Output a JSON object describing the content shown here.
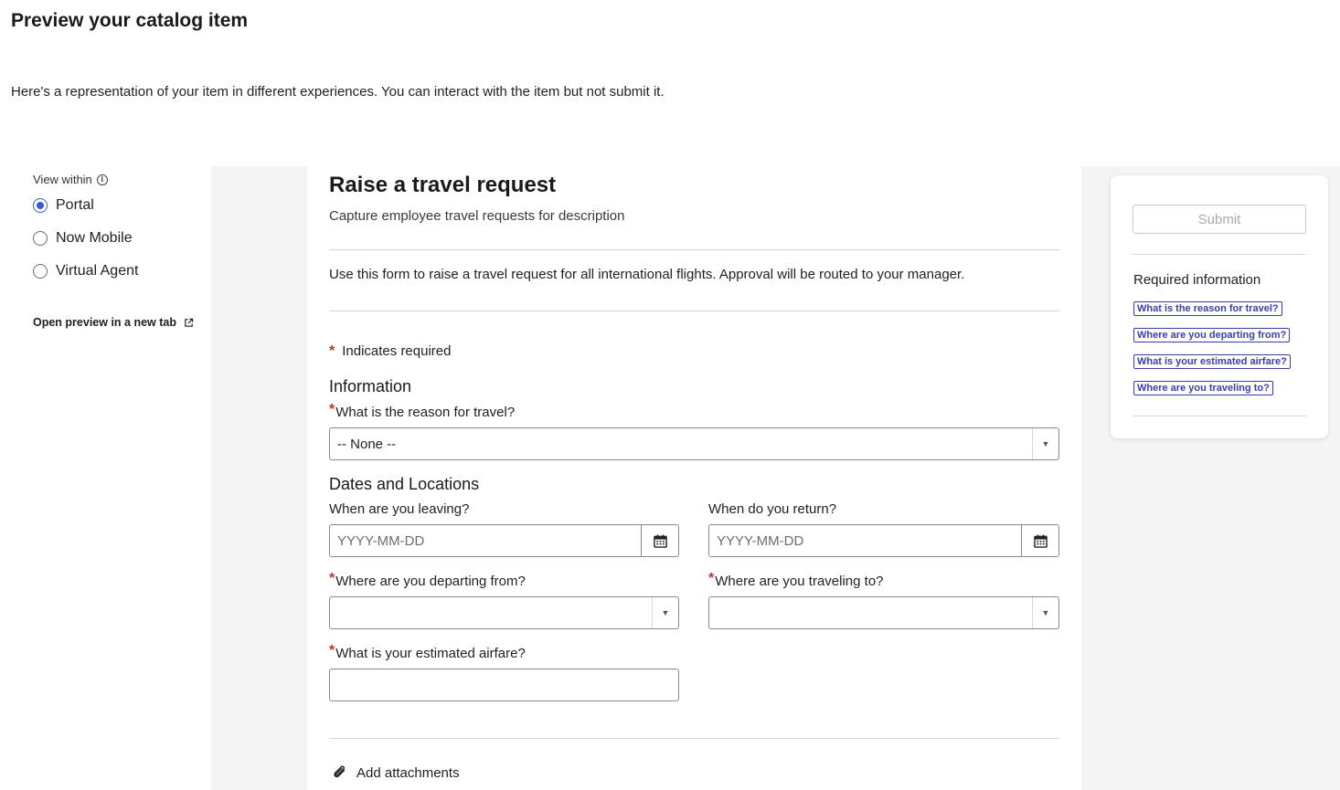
{
  "page": {
    "title": "Preview your catalog item",
    "description": "Here's a representation of your item in different experiences. You can interact with the item but not submit it."
  },
  "view_options": {
    "label": "View within",
    "options": [
      {
        "label": "Portal",
        "selected": true
      },
      {
        "label": "Now Mobile",
        "selected": false
      },
      {
        "label": "Virtual Agent",
        "selected": false
      }
    ],
    "open_preview_label": "Open preview in a new tab"
  },
  "form": {
    "title": "Raise a travel request",
    "subtitle": "Capture employee travel requests for description",
    "description": "Use this form to raise a travel request for all international flights. Approval will be routed to your manager.",
    "required_marker": "*",
    "indicates_required": "Indicates required",
    "sections": {
      "information": "Information",
      "dates_locations": "Dates and Locations"
    },
    "fields": {
      "reason": {
        "label": "What is the reason for travel?",
        "value": "-- None --"
      },
      "leaving": {
        "label": "When are you leaving?",
        "placeholder": "YYYY-MM-DD"
      },
      "return": {
        "label": "When do you return?",
        "placeholder": "YYYY-MM-DD"
      },
      "departing": {
        "label": "Where are you departing from?",
        "value": ""
      },
      "traveling_to": {
        "label": "Where are you traveling to?",
        "value": ""
      },
      "airfare": {
        "label": "What is your estimated airfare?",
        "value": ""
      }
    },
    "attachments_label": "Add attachments"
  },
  "side_panel": {
    "submit_label": "Submit",
    "required_title": "Required information",
    "required_links": [
      "What is the reason for travel?",
      "Where are you departing from?",
      "What is your estimated airfare?",
      "Where are you traveling to?"
    ]
  },
  "colors": {
    "accent": "#3c5bd1",
    "required": "#d52b2b",
    "link": "#3a3ea8",
    "preview_bg": "#f4f4f4"
  }
}
